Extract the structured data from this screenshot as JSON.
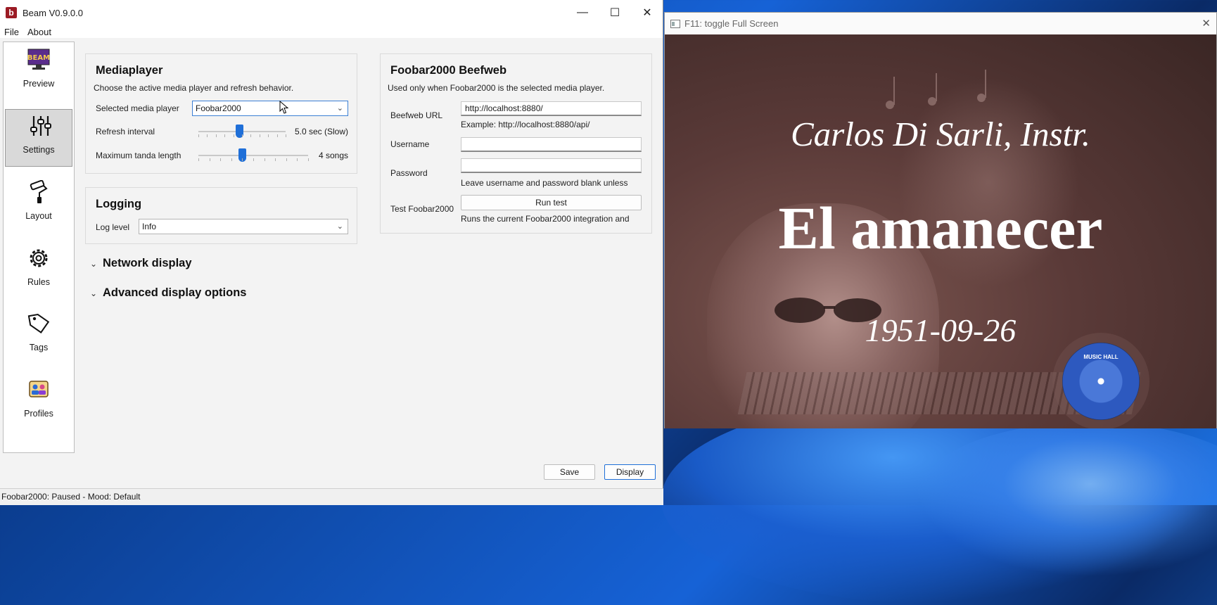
{
  "main_window": {
    "title": "Beam V0.9.0.0",
    "controls": {
      "minimize": "—",
      "maximize": "☐",
      "close": "✕"
    },
    "menu": [
      "File",
      "About"
    ]
  },
  "sidebar": {
    "items": [
      {
        "label": "Preview",
        "icon": "beam-logo-icon"
      },
      {
        "label": "Settings",
        "icon": "sliders-icon",
        "active": true
      },
      {
        "label": "Layout",
        "icon": "paint-roller-icon"
      },
      {
        "label": "Rules",
        "icon": "gear-icon"
      },
      {
        "label": "Tags",
        "icon": "tag-icon"
      },
      {
        "label": "Profiles",
        "icon": "profiles-icon"
      }
    ]
  },
  "mediaplayer": {
    "heading": "Mediaplayer",
    "description": "Choose the active media player and refresh behavior.",
    "selected_label": "Selected media player",
    "selected_value": "Foobar2000",
    "refresh_label": "Refresh interval",
    "refresh_value": "5.0 sec (Slow)",
    "refresh_fraction": 0.47,
    "tanda_label": "Maximum tanda length",
    "tanda_value": "4 songs",
    "tanda_fraction": 0.4
  },
  "logging": {
    "heading": "Logging",
    "level_label": "Log level",
    "level_value": "Info"
  },
  "expanders": {
    "network": "Network display",
    "advanced": "Advanced display options"
  },
  "beefweb": {
    "heading": "Foobar2000 Beefweb",
    "description": "Used only when Foobar2000 is the selected media player.",
    "url_label": "Beefweb URL",
    "url_value": "http://localhost:8880/",
    "url_example": "Example: http://localhost:8880/api/",
    "username_label": "Username",
    "username_value": "",
    "password_label": "Password",
    "password_value": "",
    "credentials_hint": "Leave username and password blank unless",
    "test_label": "Test Foobar2000",
    "test_button": "Run test",
    "test_hint": "Runs the current Foobar2000 integration and"
  },
  "footer": {
    "save": "Save",
    "display": "Display"
  },
  "status": "Foobar2000: Paused - Mood: Default",
  "display_window": {
    "title": "F11: toggle Full Screen",
    "close": "✕",
    "artist": "Carlos Di Sarli, Instr.",
    "song_title": "El amanecer",
    "year": "1951-09-26",
    "record_label": "MUSIC HALL"
  },
  "colors": {
    "accent": "#1f6fd8",
    "app_icon": "#9b1b24"
  }
}
